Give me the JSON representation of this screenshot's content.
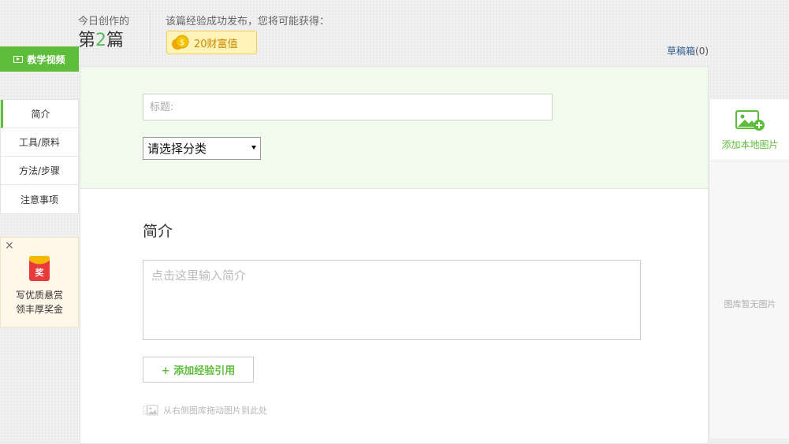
{
  "header": {
    "today_label": "今日创作的",
    "today_prefix": "第",
    "today_number": "2",
    "today_suffix": "篇",
    "reward_label": "该篇经验成功发布，您将可能获得：",
    "reward_value": "20财富值",
    "drafts_label": "草稿箱",
    "drafts_count": "(0)"
  },
  "left": {
    "tutorial_button": "教学视频",
    "nav": [
      {
        "label": "简介"
      },
      {
        "label": "工具/原料"
      },
      {
        "label": "方法/步骤"
      },
      {
        "label": "注意事项"
      }
    ],
    "award": {
      "close": "×",
      "badge_char": "奖",
      "line1": "写优质悬赏",
      "line2": "领丰厚奖金"
    }
  },
  "main": {
    "title_placeholder": "标题:",
    "category_value": "请选择分类",
    "intro_heading": "简介",
    "intro_placeholder": "点击这里输入简介",
    "add_reference": "+ 添加经验引用",
    "drag_hint": "从右侧图库拖动图片到此处"
  },
  "right": {
    "add_local": "添加本地图片",
    "gallery_empty": "图库暂无图片"
  },
  "colors": {
    "accent_green": "#5fbd3c",
    "title_bg": "#f0fbee",
    "coin_yellow": "#f5b800",
    "link_blue": "#2f5a8c"
  }
}
